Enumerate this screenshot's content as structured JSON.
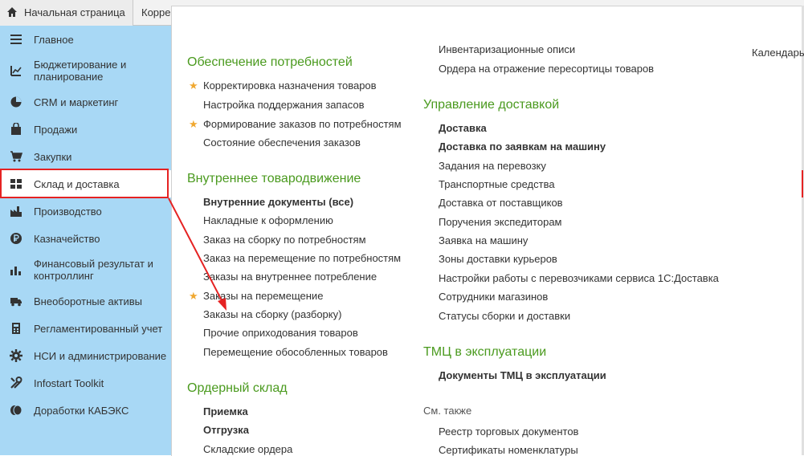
{
  "tabs": {
    "home": "Начальная страница",
    "second": "Корре"
  },
  "sidebar": {
    "items": [
      {
        "label": "Главное"
      },
      {
        "label": "Бюджетирование и планирование"
      },
      {
        "label": "CRM и маркетинг"
      },
      {
        "label": "Продажи"
      },
      {
        "label": "Закупки"
      },
      {
        "label": "Склад и доставка"
      },
      {
        "label": "Производство"
      },
      {
        "label": "Казначейство"
      },
      {
        "label": "Финансовый результат и контроллинг"
      },
      {
        "label": "Внеоборотные активы"
      },
      {
        "label": "Регламентированный учет"
      },
      {
        "label": "НСИ и администрирование"
      },
      {
        "label": "Infostart Toolkit"
      },
      {
        "label": "Доработки КАБЭКС"
      }
    ]
  },
  "calendar_label": "Календарь",
  "col1": {
    "supply_title": "Обеспечение потребностей",
    "supply_links": [
      "Корректировка назначения товаров",
      "Настройка поддержания запасов",
      "Формирование заказов по потребностям",
      "Состояние обеспечения заказов"
    ],
    "internal_title": "Внутреннее товародвижение",
    "internal_links": [
      "Внутренние документы (все)",
      "Накладные к оформлению",
      "Заказ на сборку по потребностям",
      "Заказ на перемещение по потребностям",
      "Заказы на внутреннее потребление",
      "Заказы на перемещение",
      "Заказы на сборку (разборку)",
      "Прочие оприходования товаров",
      "Перемещение обособленных товаров"
    ],
    "order_title": "Ордерный склад",
    "order_links": [
      "Приемка",
      "Отгрузка",
      "Складские ордера"
    ]
  },
  "col2": {
    "top_links": [
      "Инвентаризационные описи",
      "Ордера на отражение пересортицы товаров"
    ],
    "delivery_title": "Управление доставкой",
    "delivery_links": [
      "Доставка",
      "Доставка по заявкам на машину",
      "Задания на перевозку",
      "Транспортные средства",
      "Доставка от поставщиков",
      "Поручения экспедиторам",
      "Заявка на машину",
      "Зоны доставки курьеров",
      "Настройки работы с перевозчиками сервиса 1С:Доставка",
      "Сотрудники магазинов",
      "Статусы сборки и доставки"
    ],
    "tmc_title": "ТМЦ в эксплуатации",
    "tmc_links": [
      "Документы ТМЦ в эксплуатации"
    ],
    "see_also": "См. также",
    "see_also_links": [
      "Реестр торговых документов",
      "Сертификаты номенклатуры"
    ]
  },
  "colors": {
    "sidebar_bg": "#a8d8f5",
    "section_green": "#4a9a1e",
    "star": "#f0a830",
    "annotation_red": "#e52222"
  }
}
